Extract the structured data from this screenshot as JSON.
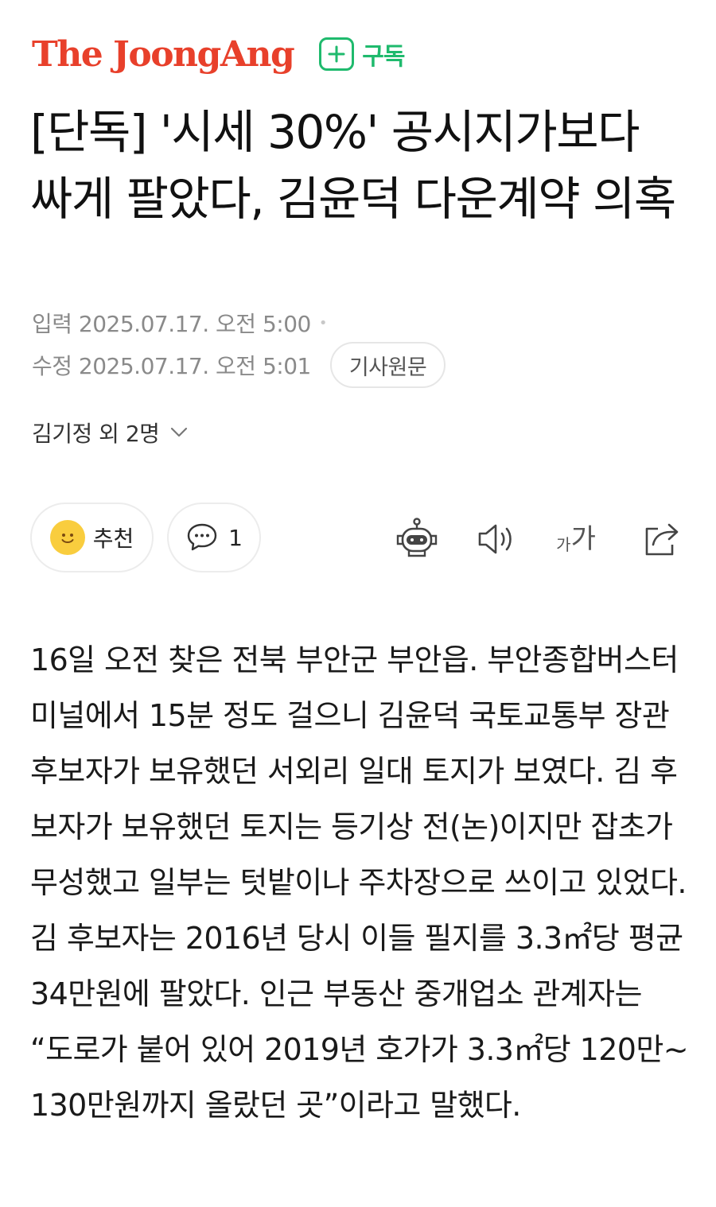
{
  "header": {
    "logo": "The JoongAng",
    "subscribe_label": "구독",
    "brand_color": "#e8402b",
    "accent_color": "#1fba6d"
  },
  "headline": "[단독] '시세 30%' 공시지가보다 싸게 팔았다, 김윤덕 다운계약 의혹",
  "meta": {
    "published": "입력 2025.07.17. 오전 5:00",
    "modified": "수정 2025.07.17. 오전 5:01",
    "original_button": "기사원문"
  },
  "author": {
    "label": "김기정 외 2명",
    "icon": "chevron-down-icon"
  },
  "actions": {
    "recommend_label": "추천",
    "comment_count": "1",
    "font_small": "가",
    "font_large": "가",
    "icons": [
      "smile-icon",
      "comment-icon",
      "robot-icon",
      "speaker-icon",
      "font-size-icon",
      "share-icon"
    ]
  },
  "article": {
    "body": "16일 오전 찾은 전북 부안군 부안읍. 부안종합버스터미널에서 15분 정도 걸으니 김윤덕 국토교통부 장관 후보자가 보유했던 서외리 일대 토지가 보였다. 김 후보자가 보유했던 토지는 등기상 전(논)이지만 잡초가 무성했고 일부는 텃밭이나 주차장으로 쓰이고 있었다. 김 후보자는 2016년 당시 이들 필지를 3.3㎡당 평균 34만원에 팔았다. 인근 부동산 중개업소 관계자는 “도로가 붙어 있어 2019년 호가가 3.3㎡당 120만~130만원까지 올랐던 곳”이라고 말했다."
  }
}
